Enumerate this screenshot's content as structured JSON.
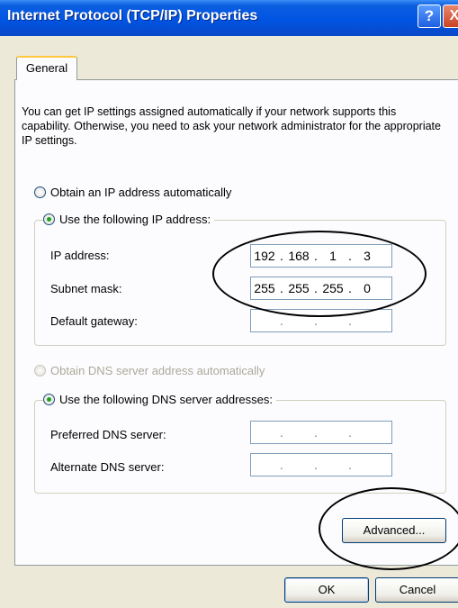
{
  "window": {
    "title": "Internet Protocol (TCP/IP) Properties",
    "help_label": "?",
    "close_label": "X"
  },
  "tabs": [
    {
      "label": "General",
      "selected": true
    }
  ],
  "description": "You can get IP settings assigned automatically if your network supports this capability. Otherwise, you need to ask your network administrator for the appropriate IP settings.",
  "ip": {
    "auto_label": "Obtain an IP address automatically",
    "auto_selected": false,
    "manual_label": "Use the following IP address:",
    "manual_selected": true,
    "fields": {
      "ip_address": {
        "label": "IP address:",
        "octets": [
          "192",
          "168",
          "1",
          "3"
        ]
      },
      "subnet_mask": {
        "label": "Subnet mask:",
        "octets": [
          "255",
          "255",
          "255",
          "0"
        ]
      },
      "default_gateway": {
        "label": "Default gateway:",
        "octets": [
          "",
          "",
          "",
          ""
        ]
      }
    }
  },
  "dns": {
    "auto_label": "Obtain DNS server address automatically",
    "auto_enabled": false,
    "manual_label": "Use the following DNS server addresses:",
    "manual_selected": true,
    "fields": {
      "preferred": {
        "label": "Preferred DNS server:",
        "octets": [
          "",
          "",
          "",
          ""
        ]
      },
      "alternate": {
        "label": "Alternate DNS server:",
        "octets": [
          "",
          "",
          "",
          ""
        ]
      }
    }
  },
  "buttons": {
    "advanced": "Advanced...",
    "ok": "OK",
    "cancel": "Cancel"
  },
  "dot": "."
}
